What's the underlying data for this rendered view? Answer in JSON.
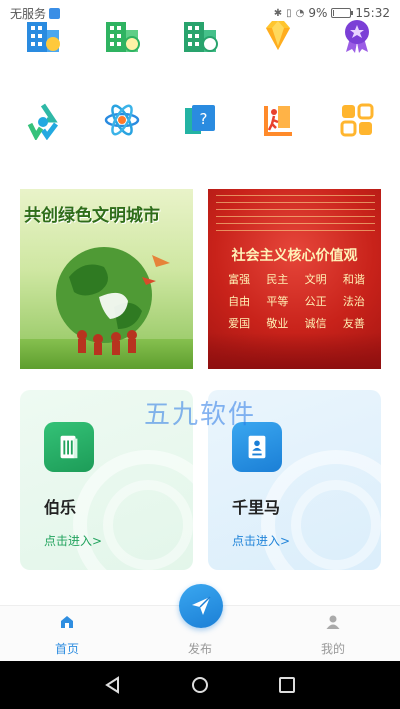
{
  "status_bar": {
    "carrier": "无服务",
    "battery": "9%",
    "battery_level": 0.09,
    "time": "15:32"
  },
  "top_grid": {
    "row1": [
      {
        "icon": "building-blue-icon"
      },
      {
        "icon": "building-green-icon"
      },
      {
        "icon": "building-teal-icon"
      },
      {
        "icon": "diamond-icon"
      },
      {
        "icon": "medal-icon"
      }
    ],
    "row2": [
      {
        "icon": "recycle-icon"
      },
      {
        "icon": "atom-icon"
      },
      {
        "icon": "question-book-icon"
      },
      {
        "icon": "exit-icon"
      },
      {
        "icon": "apps-grid-icon"
      }
    ]
  },
  "banners": {
    "left": {
      "title": "共创绿色文明城市"
    },
    "right": {
      "title": "社会主义核心价值观",
      "values": [
        "富强",
        "民主",
        "文明",
        "和谐",
        "自由",
        "平等",
        "公正",
        "法治",
        "爱国",
        "敬业",
        "诚信",
        "友善"
      ]
    }
  },
  "cards": [
    {
      "title": "伯乐",
      "link": "点击进入>",
      "icon": "document-icon"
    },
    {
      "title": "千里马",
      "link": "点击进入>",
      "icon": "profile-doc-icon"
    }
  ],
  "watermark": "五九软件",
  "bottom_nav": {
    "home": "首页",
    "publish": "发布",
    "mine": "我的"
  },
  "colors": {
    "accent": "#2f8ee0",
    "green": "#22a35e"
  }
}
